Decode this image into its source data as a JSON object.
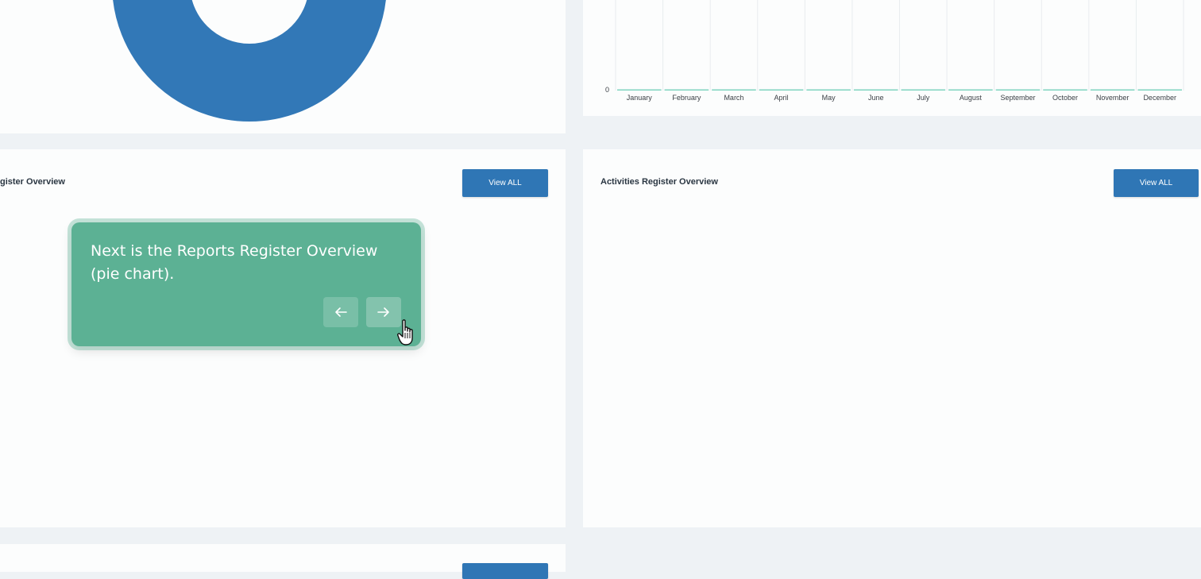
{
  "bar_chart": {
    "months": [
      "January",
      "February",
      "March",
      "April",
      "May",
      "June",
      "July",
      "August",
      "September",
      "October",
      "November",
      "December"
    ],
    "y_tick_zero": "0",
    "bar_color": "#7fd4c0"
  },
  "chart_data": {
    "type": "bar",
    "categories": [
      "January",
      "February",
      "March",
      "April",
      "May",
      "June",
      "July",
      "August",
      "September",
      "October",
      "November",
      "December"
    ],
    "values": [
      0,
      0,
      0,
      0,
      0,
      0,
      0,
      0,
      0,
      0,
      0,
      0
    ],
    "xlabel": "",
    "ylabel": "",
    "grid": true
  },
  "reports_card": {
    "title": "gister Overview",
    "view_all_label": "View ALL"
  },
  "activities_card": {
    "title": "Activities Register Overview",
    "view_all_label": "View ALL"
  },
  "tour": {
    "message": "Next is the Reports Register Overview (pie chart).",
    "prev_icon": "arrow-left-icon",
    "next_icon": "arrow-right-icon"
  },
  "colors": {
    "primary": "#2f76b5",
    "tour_bg": "#5cb194",
    "page_bg": "#eef2f5"
  }
}
